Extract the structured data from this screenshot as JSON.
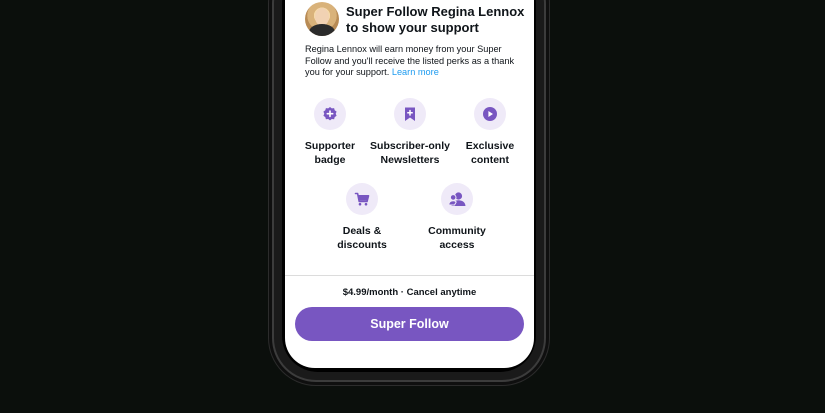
{
  "creator": {
    "title": "Super Follow Regina Lennox to show your support",
    "description": "Regina Lennox will earn money from your Super Follow and you'll receive the listed perks as a thank you for your support.",
    "learn_more": "Learn more"
  },
  "perks": [
    {
      "label": "Supporter badge",
      "icon": "badge-plus-icon"
    },
    {
      "label": "Subscriber-only Newsletters",
      "icon": "bookmark-plus-icon"
    },
    {
      "label": "Exclusive content",
      "icon": "play-circle-icon"
    },
    {
      "label": "Deals & discounts",
      "icon": "cart-icon"
    },
    {
      "label": "Community access",
      "icon": "community-icon"
    }
  ],
  "pricing": {
    "text": "$4.99/month · Cancel anytime"
  },
  "cta": {
    "label": "Super Follow"
  },
  "colors": {
    "accent": "#7856c1",
    "icon_bg": "#efeaf8",
    "link": "#1d9bf0"
  }
}
